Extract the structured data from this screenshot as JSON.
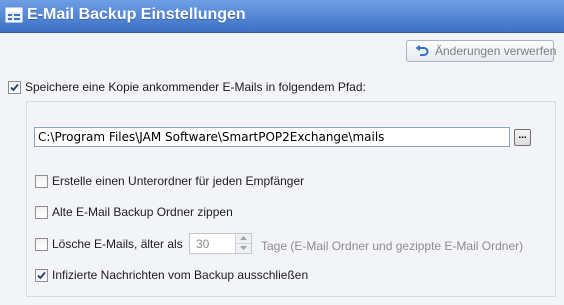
{
  "header": {
    "title": "E-Mail Backup Einstellungen",
    "icon": "settings-window-icon"
  },
  "toolbar": {
    "revert_label": "Änderungen verwerfen",
    "revert_icon": "undo-icon"
  },
  "options": {
    "save_copy": {
      "label": "Speichere eine Kopie ankommender E-Mails in folgendem Pfad:",
      "checked": true
    },
    "path": {
      "value": "C:\\Program Files\\JAM Software\\SmartPOP2Exchange\\mails",
      "browse_label": "..."
    },
    "subfolder": {
      "label": "Erstelle einen Unterordner für jeden Empfänger",
      "checked": false
    },
    "zip_old": {
      "label": "Alte E-Mail Backup Ordner zippen",
      "checked": false
    },
    "delete_older": {
      "label": "Lösche E-Mails, älter als",
      "checked": false,
      "days_value": "30",
      "days_suffix": "Tage (E-Mail Ordner und gezippte E-Mail Ordner)"
    },
    "exclude_infected": {
      "label": "Infizierte Nachrichten vom Backup ausschließen",
      "checked": true
    }
  },
  "colors": {
    "title_bar": "#3d70c6",
    "background": "#f2f4f7",
    "disabled_text": "#8c8c8c"
  }
}
